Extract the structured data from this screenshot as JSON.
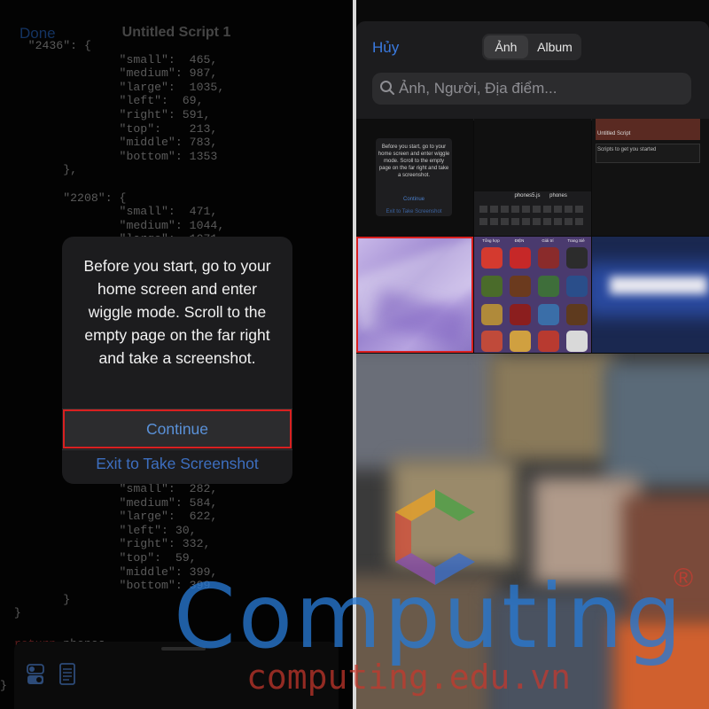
{
  "left_screen": {
    "done_label": "Done",
    "title": "Untitled Script 1",
    "code_lines": [
      "    \"2436\": {",
      "                 \"small\":  465,",
      "                 \"medium\": 987,",
      "                 \"large\":  1035,",
      "                 \"left\":  69,",
      "                 \"right\": 591,",
      "                 \"top\":    213,",
      "                 \"middle\": 783,",
      "                 \"bottom\": 1353",
      "         },",
      "",
      "         \"2208\": {",
      "                 \"small\":  471,",
      "                 \"medium\": 1044,",
      "                 \"large\":  1071,"
    ],
    "code_lines_bottom": [
      "                 \"small\":  282,",
      "                 \"medium\": 584,",
      "                 \"large\":  622,",
      "                 \"left\": 30,",
      "                 \"right\": 332,",
      "                 \"top\":  59,",
      "                 \"middle\": 399,",
      "                 \"bottom\": 399",
      "         }",
      "  }"
    ],
    "return_keyword": "return",
    "return_rest": " phones",
    "closing_brace": "}",
    "alert": {
      "message": "Before you start, go to your home screen and enter wiggle mode. Scroll to the empty page on the far right and take a screenshot.",
      "continue_label": "Continue",
      "exit_label": "Exit to Take Screenshot"
    }
  },
  "right_screen": {
    "cancel_label": "Hủy",
    "tabs": [
      {
        "label": "Ảnh",
        "active": true
      },
      {
        "label": "Album",
        "active": false
      }
    ],
    "search_placeholder": "Ảnh, Người, Địa điểm...",
    "thumb1_text": "Before you start, go to your home screen and enter wiggle mode. Scroll to the empty page on the far right and take a screenshot.",
    "thumb1_continue": "Continue",
    "thumb1_exit": "Exit to Take Screenshot",
    "thumb2_file": "phones5.js",
    "thumb2_file2": "phones",
    "thumb3_title": "Untitled Script",
    "thumb3_text": "Scripts to get you started",
    "app_labels": [
      "Tổng hợp",
      "ĐIỆN",
      "Giải trí",
      "Trang Siê"
    ]
  },
  "watermark": {
    "brand": "Computing",
    "registered": "®",
    "url": "computing.edu.vn"
  },
  "colors": {
    "ios_blue": "#3a7ae0",
    "highlight_red": "#d92020",
    "brand_blue": "#2878d2",
    "brand_red": "#c8372d"
  }
}
